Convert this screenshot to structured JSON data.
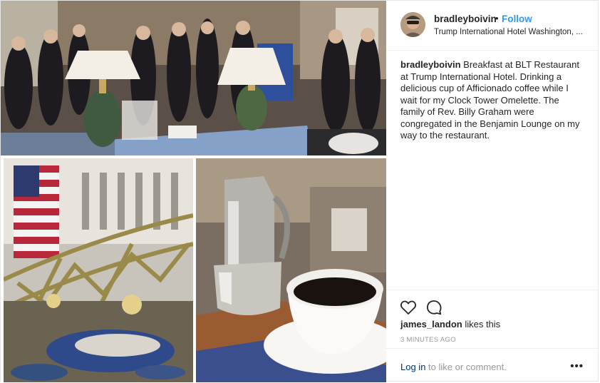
{
  "post": {
    "author": {
      "username": "bradleyboivin",
      "follow_label": "Follow",
      "separator": "•",
      "location": "Trump International Hotel Washington, ..."
    },
    "caption": {
      "username": "bradleyboivin",
      "text": "Breakfast at BLT Restaurant at Trump International Hotel. Drinking a delicious cup of Afficionado coffee while I wait for my Clock Tower Omelette. The family of Rev. Billy Graham were congregated in the Benjamin Lounge on my way to the restaurant."
    },
    "actions": {
      "like_icon": "heart-icon",
      "comment_icon": "comment-icon"
    },
    "likes": {
      "liker": "james_landon",
      "suffix": "likes this"
    },
    "timestamp": "3 MINUTES AGO",
    "comment_prompt": {
      "login_label": "Log in",
      "rest": "to like or comment."
    },
    "more_icon": "more-options-icon",
    "more_label": "•••"
  }
}
